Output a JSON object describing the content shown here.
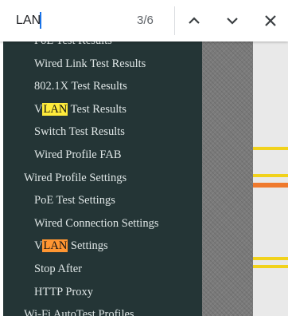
{
  "find_bar": {
    "query": "LAN",
    "match_count": "3/6"
  },
  "sidebar": {
    "items": [
      {
        "level": 2,
        "pre": "",
        "match": "",
        "post": "PoE Test Results",
        "state": ""
      },
      {
        "level": 2,
        "pre": "",
        "match": "",
        "post": "Wired Link Test Results",
        "state": ""
      },
      {
        "level": 2,
        "pre": "",
        "match": "",
        "post": "802.1X Test Results",
        "state": ""
      },
      {
        "level": 2,
        "pre": "V",
        "match": "LAN",
        "post": " Test Results",
        "state": "match"
      },
      {
        "level": 2,
        "pre": "",
        "match": "",
        "post": "Switch Test Results",
        "state": ""
      },
      {
        "level": 2,
        "pre": "",
        "match": "",
        "post": "Wired Profile FAB",
        "state": ""
      },
      {
        "level": 1,
        "pre": "",
        "match": "",
        "post": "Wired Profile Settings",
        "state": ""
      },
      {
        "level": 2,
        "pre": "",
        "match": "",
        "post": "PoE Test Settings",
        "state": ""
      },
      {
        "level": 2,
        "pre": "",
        "match": "",
        "post": "Wired Connection Settings",
        "state": ""
      },
      {
        "level": 2,
        "pre": "V",
        "match": "LAN",
        "post": " Settings",
        "state": "current"
      },
      {
        "level": 2,
        "pre": "",
        "match": "",
        "post": "Stop After",
        "state": ""
      },
      {
        "level": 2,
        "pre": "",
        "match": "",
        "post": "HTTP Proxy",
        "state": ""
      },
      {
        "level": 1,
        "pre": "",
        "match": "",
        "post": "Wi-Fi AutoTest Profiles",
        "state": ""
      }
    ]
  },
  "icons": {
    "previous": "chevron-up-icon",
    "next": "chevron-down-icon",
    "close": "close-icon"
  },
  "colors": {
    "nav_background": "#243536",
    "match_highlight": "#ffeb3b",
    "current_match_highlight": "#ff9632",
    "caret": "#1a73e8"
  }
}
